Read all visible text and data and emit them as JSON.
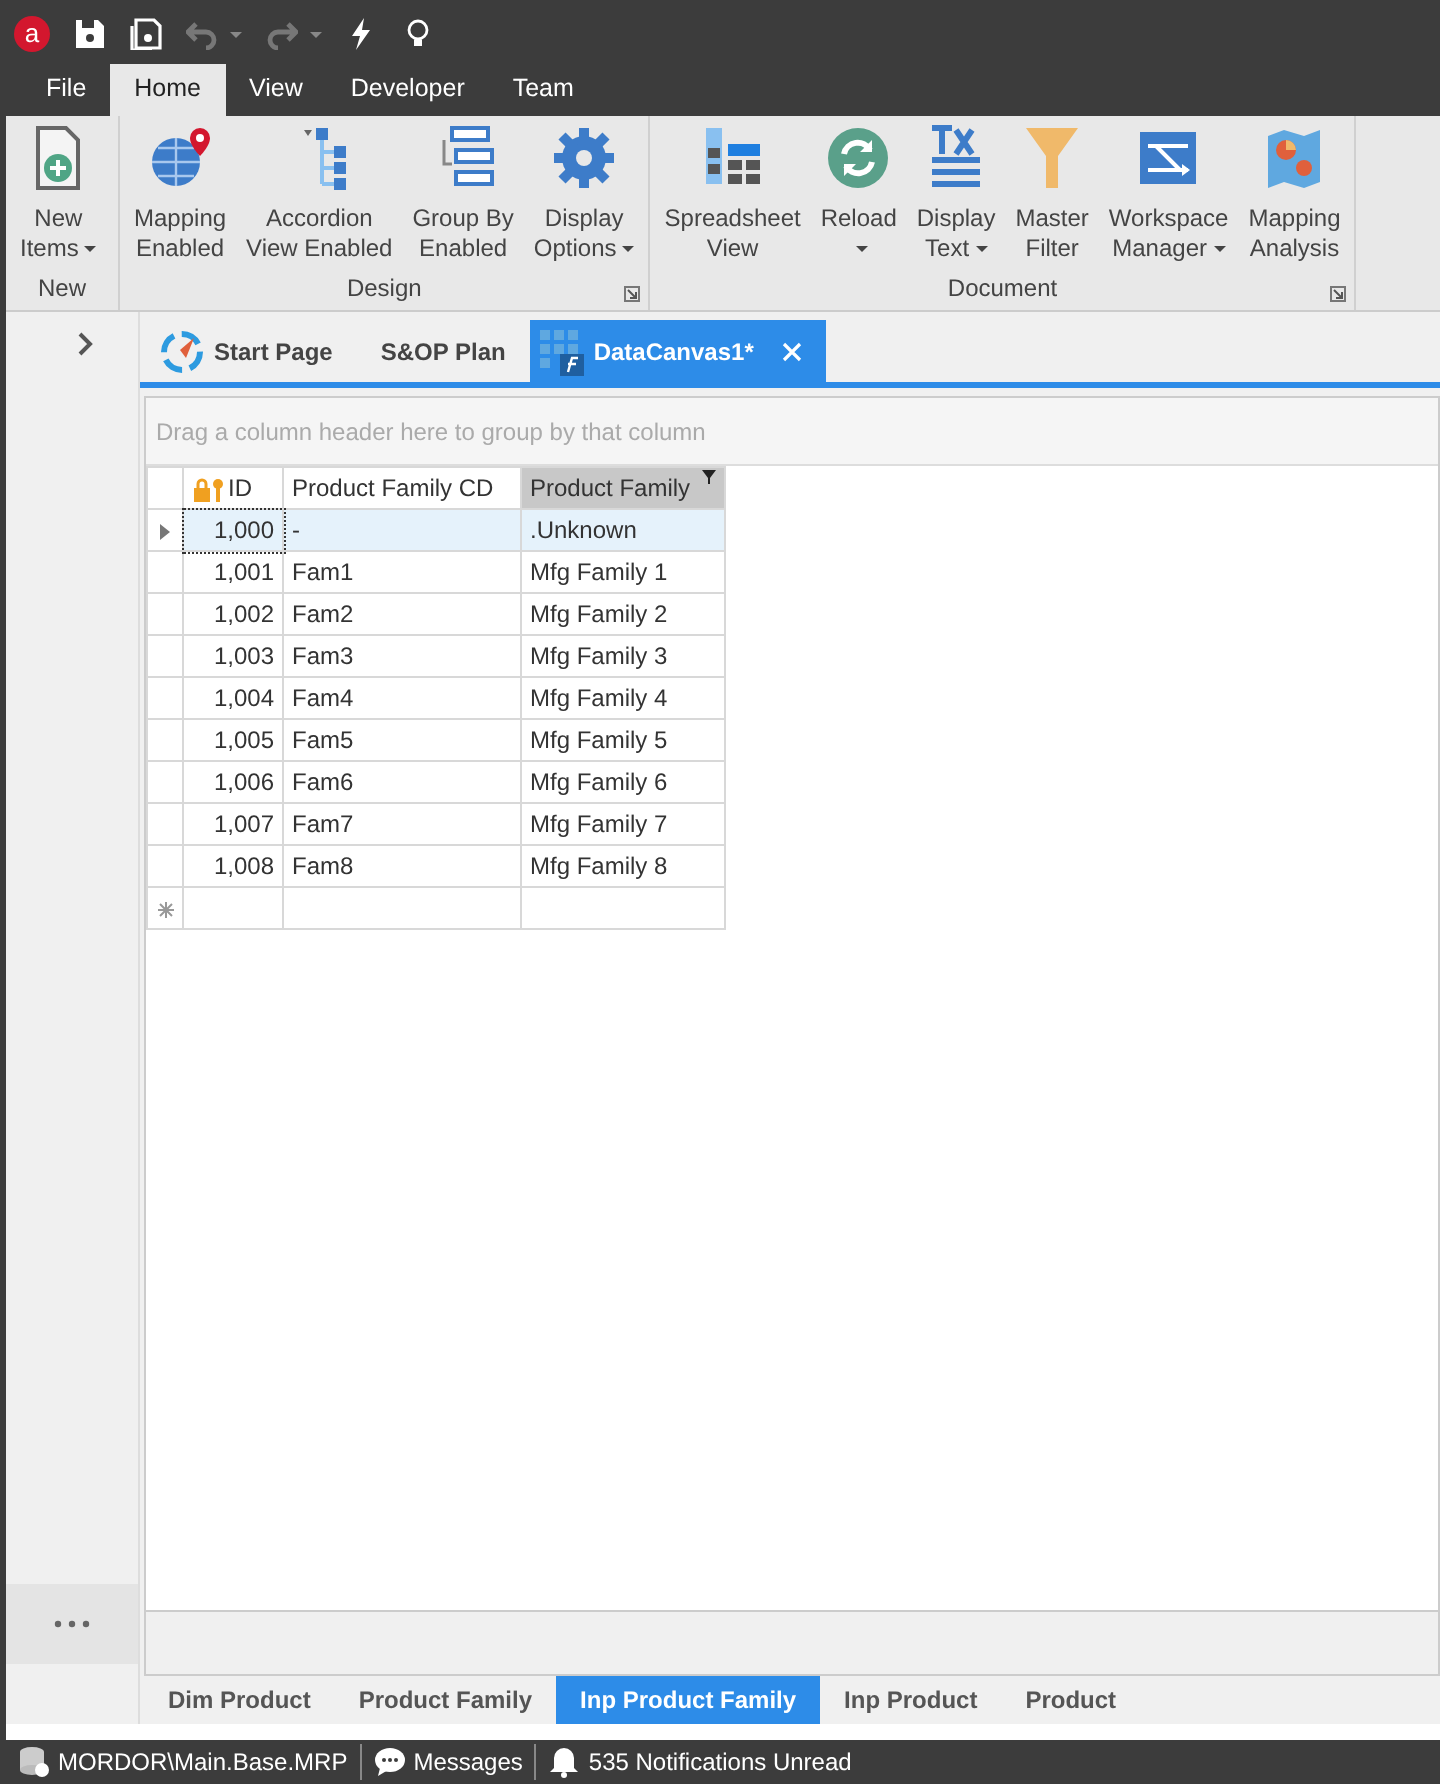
{
  "app": {
    "logo": "a"
  },
  "quick_access": [
    {
      "disabled": false,
      "dropdown": false
    },
    {
      "disabled": false,
      "dropdown": false
    },
    {
      "disabled": true,
      "dropdown": true
    },
    {
      "disabled": true,
      "dropdown": true
    },
    {
      "disabled": false,
      "dropdown": false
    },
    {
      "disabled": false,
      "dropdown": false
    }
  ],
  "menu_tabs": [
    {
      "label": "File",
      "selected": false
    },
    {
      "label": "Home",
      "selected": true
    },
    {
      "label": "View",
      "selected": false
    },
    {
      "label": "Developer",
      "selected": false
    },
    {
      "label": "Team",
      "selected": false
    }
  ],
  "ribbon_groups": [
    {
      "title": "New",
      "launcher": false,
      "buttons": [
        {
          "lines": [
            "New",
            "Items"
          ],
          "dropdown": true
        }
      ]
    },
    {
      "title": "Design",
      "launcher": true,
      "buttons": [
        {
          "lines": [
            "Mapping",
            "Enabled"
          ],
          "dropdown": false
        },
        {
          "lines": [
            "Accordion",
            "View Enabled"
          ],
          "dropdown": false
        },
        {
          "lines": [
            "Group By",
            "Enabled"
          ],
          "dropdown": false
        },
        {
          "lines": [
            "Display",
            "Options"
          ],
          "dropdown": true
        }
      ]
    },
    {
      "title": "Document",
      "launcher": true,
      "buttons": [
        {
          "lines": [
            "Spreadsheet",
            "View"
          ],
          "dropdown": false
        },
        {
          "lines": [
            "Reload"
          ],
          "dropdown": true
        },
        {
          "lines": [
            "Display",
            "Text"
          ],
          "dropdown": true
        },
        {
          "lines": [
            "Master",
            "Filter"
          ],
          "dropdown": false
        },
        {
          "lines": [
            "Workspace",
            "Manager"
          ],
          "dropdown": true
        },
        {
          "lines": [
            "Mapping",
            "Analysis"
          ],
          "dropdown": false
        }
      ]
    }
  ],
  "doc_tabs": [
    {
      "label": "Start Page",
      "selected": false,
      "closable": false
    },
    {
      "label": "S&OP Plan",
      "selected": false,
      "closable": false
    },
    {
      "label": "DataCanvas1*",
      "selected": true,
      "closable": true
    }
  ],
  "grid": {
    "group_panel": {
      "placeholder": "Drag a column header here to group by that column"
    },
    "columns": [
      {
        "label": "ID",
        "key_icon": true,
        "filtered": false
      },
      {
        "label": "Product Family CD",
        "key_icon": false,
        "filtered": false
      },
      {
        "label": "Product Family",
        "key_icon": false,
        "filtered": true
      }
    ],
    "rows": [
      {
        "cells": [
          "1,000",
          "-",
          ".Unknown"
        ],
        "selected": true
      },
      {
        "cells": [
          "1,001",
          "Fam1",
          "Mfg Family 1"
        ],
        "selected": false
      },
      {
        "cells": [
          "1,002",
          "Fam2",
          "Mfg Family 2"
        ],
        "selected": false
      },
      {
        "cells": [
          "1,003",
          "Fam3",
          "Mfg Family 3"
        ],
        "selected": false
      },
      {
        "cells": [
          "1,004",
          "Fam4",
          "Mfg Family 4"
        ],
        "selected": false
      },
      {
        "cells": [
          "1,005",
          "Fam5",
          "Mfg Family 5"
        ],
        "selected": false
      },
      {
        "cells": [
          "1,006",
          "Fam6",
          "Mfg Family 6"
        ],
        "selected": false
      },
      {
        "cells": [
          "1,007",
          "Fam7",
          "Mfg Family 7"
        ],
        "selected": false
      },
      {
        "cells": [
          "1,008",
          "Fam8",
          "Mfg Family 8"
        ],
        "selected": false
      }
    ],
    "new_row": true
  },
  "sheet_tabs": [
    {
      "label": "Dim Product",
      "selected": false
    },
    {
      "label": "Product Family",
      "selected": false
    },
    {
      "label": "Inp Product Family",
      "selected": true
    },
    {
      "label": "Inp Product",
      "selected": false
    },
    {
      "label": "Product",
      "selected": false
    }
  ],
  "status_bar": [
    {
      "text": "MORDOR\\Main.Base.MRP"
    },
    {
      "text": "Messages"
    },
    {
      "text": "535 Notifications Unread"
    }
  ]
}
